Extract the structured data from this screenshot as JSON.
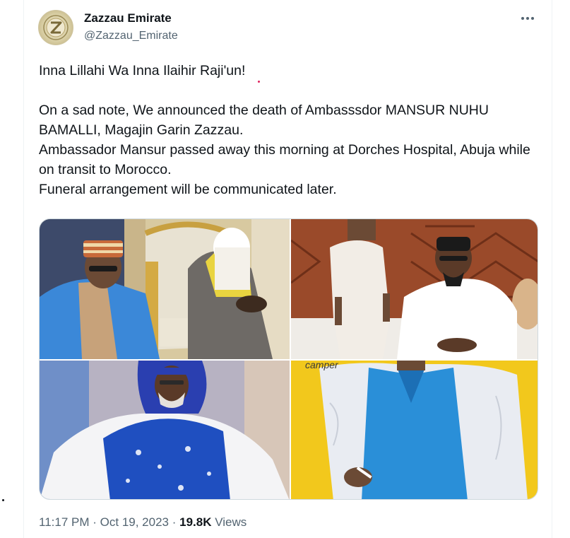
{
  "tweet": {
    "display_name": "Zazzau Emirate",
    "handle": "@Zazzau_Emirate",
    "avatar_icon": "emirate-logo-icon",
    "more_icon": "more-horizontal-icon",
    "text_lines": [
      "Inna Lillahi Wa Inna Ilaihir Raji'un!",
      "On a sad note, We announced the death of Ambasssdor MANSUR NUHU BAMALLI, Magajin Garin Zazzau.",
      "Ambassador Mansur passed away this morning at Dorches Hospital, Abuja while on transit to Morocco.",
      "Funeral arrangement will be communicated later."
    ],
    "time": "11:17 PM",
    "separator": "·",
    "date": "Oct 19, 2023",
    "views_count": "19.8K",
    "views_label": "Views"
  },
  "photos": [
    {
      "name": "photo-1",
      "caption_text": ""
    },
    {
      "name": "photo-2",
      "caption_text": ""
    },
    {
      "name": "photo-3",
      "caption_text": ""
    },
    {
      "name": "photo-4",
      "caption_text": "camper"
    }
  ],
  "colors": {
    "text_primary": "#0f1419",
    "text_secondary": "#536471",
    "border": "#cfd9de"
  }
}
